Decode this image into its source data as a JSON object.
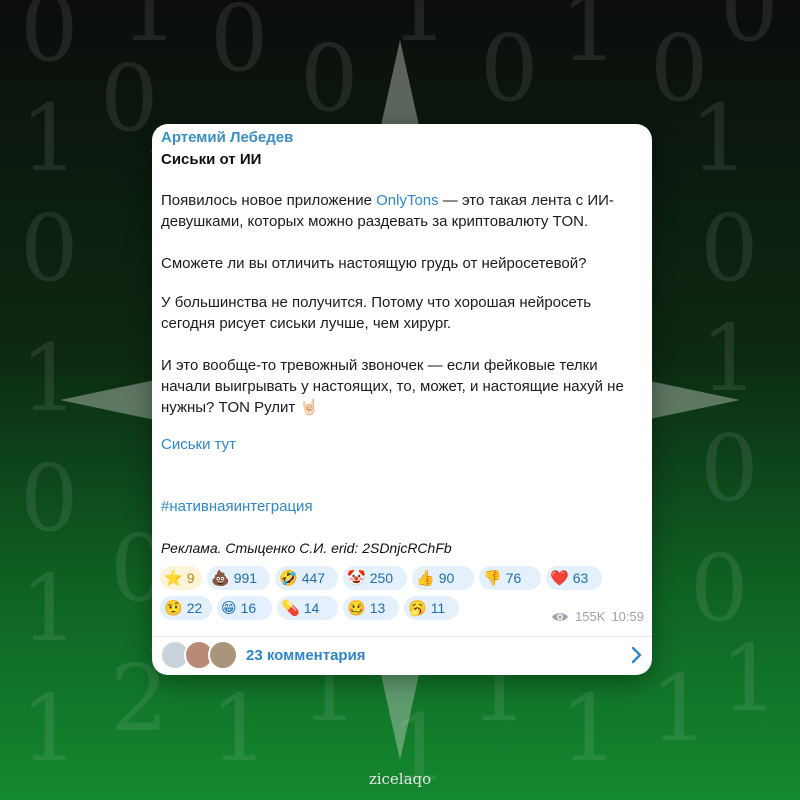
{
  "post": {
    "author": "Артемий Лебедев",
    "title": "Сиськи от ИИ",
    "p1_before": "Появилось новое приложение ",
    "p1_link": "OnlyTons",
    "p1_after": " — это такая лента с ИИ-девушками, которых можно раздевать за криптовалюту TON.",
    "p2": "Сможете ли вы отличить настоящую грудь от нейросетевой?",
    "p3": "У большинства не получится. Потому что хорошая нейросеть сегодня рисует сиськи лучше, чем хирург.",
    "p4": "И это вообще-то тревожный звоночек — если фейковые телки начали выигрывать у настоящих, то, может, и настоящие нахуй не нужны? TON Рулит 🤘🏻",
    "link_text": "Сиськи тут",
    "hashtag": "#нативнаяинтеграция",
    "ad_text": "Реклама. Стыценко С.И. erid: 2SDnjcRChFb"
  },
  "reactions": [
    {
      "emoji": "⭐",
      "count": "9",
      "icon": "star-icon"
    },
    {
      "emoji": "💩",
      "count": "991",
      "icon": "poop-icon"
    },
    {
      "emoji": "🤣",
      "count": "447",
      "icon": "rofl-icon"
    },
    {
      "emoji": "🤡",
      "count": "250",
      "icon": "clown-icon"
    },
    {
      "emoji": "👍",
      "count": "90",
      "icon": "thumbs-up-icon"
    },
    {
      "emoji": "👎",
      "count": "76",
      "icon": "thumbs-down-icon"
    },
    {
      "emoji": "❤️",
      "count": "63",
      "icon": "heart-icon"
    },
    {
      "emoji": "🤨",
      "count": "22",
      "icon": "raised-eyebrow-icon"
    },
    {
      "emoji": "😁",
      "count": "16",
      "icon": "grin-icon"
    },
    {
      "emoji": "💊",
      "count": "14",
      "icon": "pill-icon"
    },
    {
      "emoji": "🥴",
      "count": "13",
      "icon": "woozy-face-icon"
    },
    {
      "emoji": "🥱",
      "count": "11",
      "icon": "yawn-icon"
    }
  ],
  "meta": {
    "views": "155K",
    "time": "10:59"
  },
  "comments": {
    "label": "23 комментария"
  },
  "brand": "zicelaqo",
  "colors": {
    "accent": "#2f86c8",
    "author": "#3a8fc6",
    "reaction_bg": "#e4f0fb",
    "paid_bg": "#fdf3d8",
    "bg_green": "#0f7a2a"
  }
}
